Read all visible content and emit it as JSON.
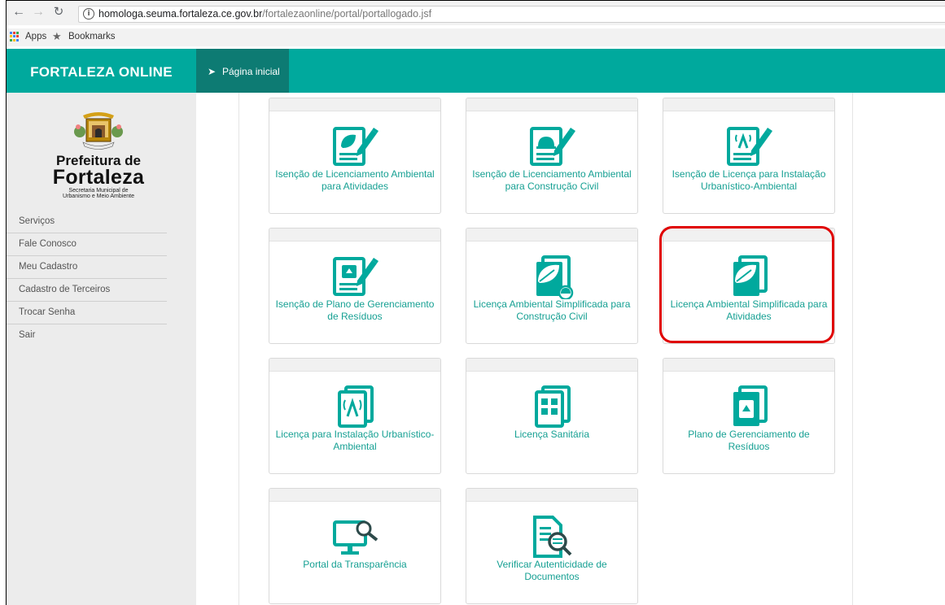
{
  "browser": {
    "url_host": "homologa.seuma.fortaleza.ce.gov.br",
    "url_path": "/fortalezaonline/portal/portallogado.jsf",
    "bookmarks": [
      "Apps",
      "Bookmarks"
    ]
  },
  "header": {
    "brand": "FORTALEZA ONLINE",
    "home_tab": "Página inicial"
  },
  "logo": {
    "line1": "Prefeitura de",
    "line2": "Fortaleza",
    "line3": "Secretaria Municipal de",
    "line4": "Urbanismo e Meio Ambiente",
    "seal_text": "FORTITUDINE"
  },
  "sidebar": {
    "items": [
      "Serviços",
      "Fale Conosco",
      "Meu Cadastro",
      "Cadastro de Terceiros",
      "Trocar Senha",
      "Sair"
    ]
  },
  "cards": [
    {
      "title": "Isenção de Licenciamento Ambiental para Atividades",
      "icon": "leaf-form-pen-icon"
    },
    {
      "title": "Isenção de Licenciamento Ambiental para Construção Civil",
      "icon": "helmet-form-pen-icon"
    },
    {
      "title": "Isenção de Licença para Instalação Urbanístico-Ambiental",
      "icon": "antenna-form-pen-icon"
    },
    {
      "title": "Isenção de Plano de Gerenciamento de Resíduos",
      "icon": "recycle-form-pen-icon"
    },
    {
      "title": "Licença Ambiental Simplificada para Construção Civil",
      "icon": "leaf-document-helmet-icon"
    },
    {
      "title": "Licença Ambiental Simplificada para Atividades",
      "icon": "leaf-document-icon"
    },
    {
      "title": "Licença para Instalação Urbanístico-Ambiental",
      "icon": "antenna-document-icon"
    },
    {
      "title": "Licença Sanitária",
      "icon": "sanitary-document-icon"
    },
    {
      "title": "Plano de Gerenciamento de Resíduos",
      "icon": "recycle-document-icon"
    },
    {
      "title": "Portal da Transparência",
      "icon": "monitor-magnifier-icon"
    },
    {
      "title": "Verificar Autenticidade de Documentos",
      "icon": "document-magnifier-icon"
    }
  ],
  "colors": {
    "teal": "#00a99d",
    "teal_dark": "#0d7b73",
    "card_text": "#16a093",
    "highlight": "#e00000"
  }
}
